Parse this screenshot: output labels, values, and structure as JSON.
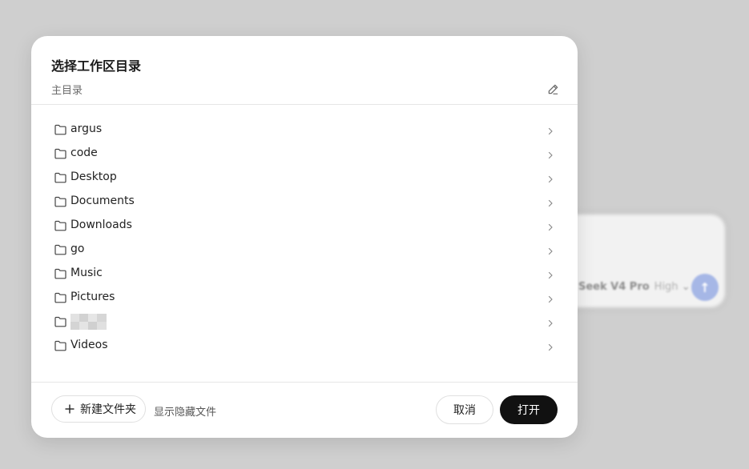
{
  "dialog": {
    "title": "选择工作区目录",
    "current_path": "主目录",
    "edit_icon": "pencil-icon"
  },
  "folders": [
    {
      "name": "argus"
    },
    {
      "name": "code"
    },
    {
      "name": "Desktop"
    },
    {
      "name": "Documents"
    },
    {
      "name": "Downloads"
    },
    {
      "name": "go"
    },
    {
      "name": "Music"
    },
    {
      "name": "Pictures"
    },
    {
      "name": "",
      "redacted": true
    },
    {
      "name": "Videos"
    }
  ],
  "footer": {
    "new_folder_label": "新建文件夹",
    "show_hidden_label": "显示隐藏文件",
    "cancel_label": "取消",
    "open_label": "打开"
  },
  "background": {
    "model_name": "Seek V4 Pro",
    "model_level": "High"
  },
  "colors": {
    "primary_button": "#111111",
    "backdrop": "#cfcfcf",
    "send_button": "#a6b7e6"
  }
}
